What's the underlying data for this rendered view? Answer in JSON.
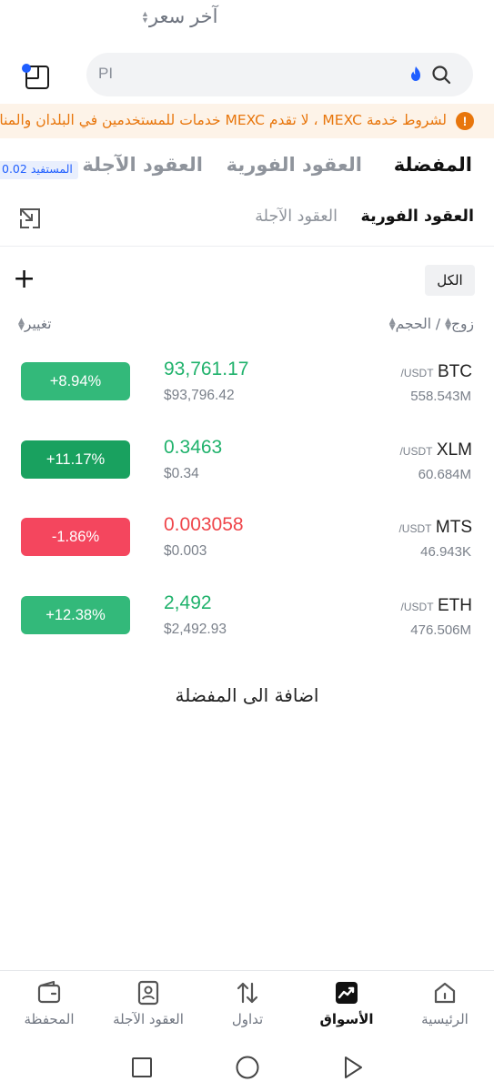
{
  "search": {
    "placeholder": "PI"
  },
  "banner": {
    "text": "لشروط خدمة MEXC ، لا تقدم MEXC خدمات للمستخدمين في البلدان والمناطق المحظورة"
  },
  "main_tabs": {
    "favorites": "المفضلة",
    "spot": "العقود الفورية",
    "futures": "العقود الآجلة",
    "promo": "المستفيد 0.02"
  },
  "sub_tabs": {
    "spot": "العقود الفورية",
    "futures": "العقود الآجلة"
  },
  "filter": {
    "all": "الكل"
  },
  "columns": {
    "pair": "زوج",
    "volume": "/ الحجم",
    "last_price": "آخر سعر",
    "change": "تغيير"
  },
  "rows": [
    {
      "base": "BTC",
      "quote": "/USDT",
      "volume": "558.543M",
      "price": "93,761.17",
      "usd": "$93,796.42",
      "change": "+8.94%",
      "price_color": "#20b26c",
      "change_color": "#33b97a"
    },
    {
      "base": "XLM",
      "quote": "/USDT",
      "volume": "60.684M",
      "price": "0.3463",
      "usd": "$0.34",
      "change": "+11.17%",
      "price_color": "#20b26c",
      "change_color": "#19a15f"
    },
    {
      "base": "MTS",
      "quote": "/USDT",
      "volume": "46.943K",
      "price": "0.003058",
      "usd": "$0.003",
      "change": "-1.86%",
      "price_color": "#ef454a",
      "change_color": "#f4465e"
    },
    {
      "base": "ETH",
      "quote": "/USDT",
      "volume": "476.506M",
      "price": "2,492",
      "usd": "$2,492.93",
      "change": "+12.38%",
      "price_color": "#20b26c",
      "change_color": "#33b97a"
    }
  ],
  "add_favorites": "اضافة الى المفضلة",
  "bottom_nav": [
    {
      "label": "الرئيسية",
      "icon": "home-icon"
    },
    {
      "label": "الأسواق",
      "icon": "markets-chart-icon"
    },
    {
      "label": "تداول",
      "icon": "trade-arrows-icon"
    },
    {
      "label": "العقود الآجلة",
      "icon": "futures-doc-icon"
    },
    {
      "label": "المحفظة",
      "icon": "wallet-icon"
    }
  ],
  "colors": {
    "up": "#20b26c",
    "down": "#ef454a",
    "warning": "#e8760c",
    "accent": "#1f5eff"
  }
}
